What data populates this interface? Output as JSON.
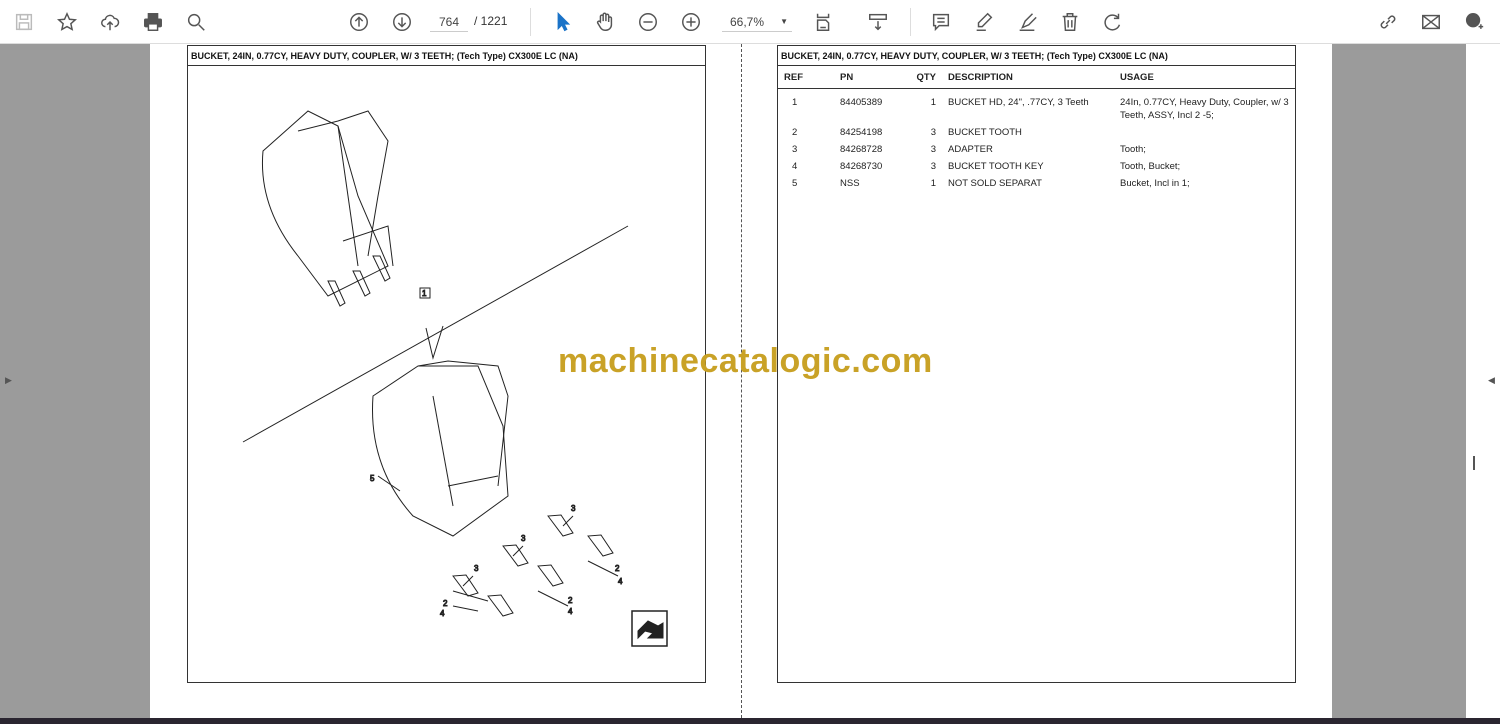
{
  "toolbar": {
    "page_current": "764",
    "page_total": "/ 1221",
    "zoom": "66,7%"
  },
  "left_panel": {
    "title": "BUCKET, 24IN, 0.77CY, HEAVY DUTY, COUPLER, W/ 3 TEETH; (Tech Type) CX300E LC (NA)",
    "callouts": {
      "c1": "1",
      "c2": "2",
      "c3": "3",
      "c4": "4",
      "c5": "5"
    }
  },
  "right_panel": {
    "title": "BUCKET, 24IN, 0.77CY, HEAVY DUTY, COUPLER, W/ 3 TEETH; (Tech Type) CX300E LC (NA)",
    "headers": [
      "REF",
      "PN",
      "QTY",
      "DESCRIPTION",
      "USAGE"
    ],
    "rows": [
      [
        "1",
        "84405389",
        "1",
        "BUCKET HD, 24\", .77CY, 3 Teeth",
        "24In, 0.77CY, Heavy Duty, Coupler, w/ 3 Teeth, ASSY, Incl 2 -5;"
      ],
      [
        "2",
        "84254198",
        "3",
        "BUCKET TOOTH",
        ""
      ],
      [
        "3",
        "84268728",
        "3",
        "ADAPTER",
        "Tooth;"
      ],
      [
        "4",
        "84268730",
        "3",
        "BUCKET TOOTH KEY",
        "Tooth, Bucket;"
      ],
      [
        "5",
        "NSS",
        "1",
        "NOT SOLD SEPARAT",
        "Bucket, Incl in 1;"
      ]
    ]
  },
  "watermark": "machinecatalogic.com",
  "colors": {
    "accent": "#1a73c8",
    "watermark": "#c9a227"
  }
}
